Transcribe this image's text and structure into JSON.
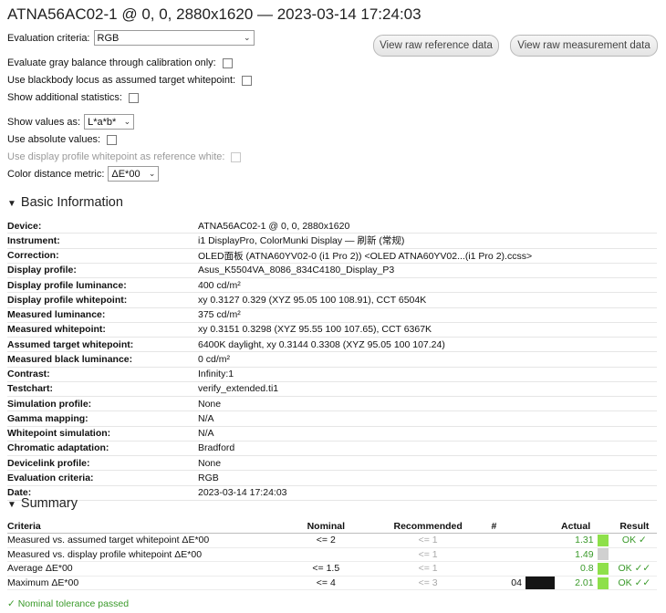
{
  "title": "ATNA56AC02-1 @ 0, 0, 2880x1620 — 2023-03-14 17:24:03",
  "controls": {
    "eval_criteria_label": "Evaluation criteria:",
    "eval_criteria_value": "RGB",
    "gray_balance_label": "Evaluate gray balance through calibration only:",
    "blackbody_label": "Use blackbody locus as assumed target whitepoint:",
    "additional_stats_label": "Show additional statistics:",
    "show_values_label": "Show values as:",
    "show_values_value": "L*a*b*",
    "absolute_label": "Use absolute values:",
    "display_profile_wp_label": "Use display profile whitepoint as reference white:",
    "color_distance_label": "Color distance metric:",
    "color_distance_value": "ΔE*00"
  },
  "buttons": {
    "raw_reference": "View raw reference data",
    "raw_measurement": "View raw measurement data"
  },
  "basic": {
    "heading": "Basic Information",
    "rows": [
      {
        "k": "Device:",
        "v": "ATNA56AC02-1 @ 0, 0, 2880x1620"
      },
      {
        "k": "Instrument:",
        "v": "i1 DisplayPro, ColorMunki Display — 刷新 (常规)"
      },
      {
        "k": "Correction:",
        "v": "OLED面板 (ATNA60YV02-0 (i1 Pro 2)) <OLED ATNA60YV02...(i1 Pro 2).ccss>"
      },
      {
        "k": "Display profile:",
        "v": "Asus_K5504VA_8086_834C4180_Display_P3"
      },
      {
        "k": "Display profile luminance:",
        "v": "400 cd/m²"
      },
      {
        "k": "Display profile whitepoint:",
        "v": "xy 0.3127 0.329 (XYZ 95.05 100 108.91), CCT 6504K"
      },
      {
        "k": "Measured luminance:",
        "v": "375 cd/m²"
      },
      {
        "k": "Measured whitepoint:",
        "v": "xy 0.3151 0.3298 (XYZ 95.55 100 107.65), CCT 6367K"
      },
      {
        "k": "Assumed target whitepoint:",
        "v": "6400K daylight, xy 0.3144 0.3308 (XYZ 95.05 100 107.24)"
      },
      {
        "k": "Measured black luminance:",
        "v": "0 cd/m²"
      },
      {
        "k": "Contrast:",
        "v": "Infinity:1"
      },
      {
        "k": "Testchart:",
        "v": "verify_extended.ti1"
      },
      {
        "k": "Simulation profile:",
        "v": "None"
      },
      {
        "k": "Gamma mapping:",
        "v": "N/A"
      },
      {
        "k": "Whitepoint simulation:",
        "v": "N/A"
      },
      {
        "k": "Chromatic adaptation:",
        "v": "Bradford"
      },
      {
        "k": "Devicelink profile:",
        "v": "None"
      },
      {
        "k": "Evaluation criteria:",
        "v": "RGB"
      },
      {
        "k": "Date:",
        "v": "2023-03-14 17:24:03"
      }
    ]
  },
  "summary": {
    "heading": "Summary",
    "columns": {
      "criteria": "Criteria",
      "nominal": "Nominal",
      "recommended": "Recommended",
      "num": "#",
      "actual": "Actual",
      "result": "Result"
    },
    "rows": [
      {
        "criteria": "Measured vs. assumed target whitepoint ΔE*00",
        "nominal": "<= 2",
        "recommended": "<= 1",
        "num": "",
        "actual": "1.31",
        "result": "OK ✓",
        "color": "#8ee04a",
        "swatch": ""
      },
      {
        "criteria": "Measured vs. display profile whitepoint ΔE*00",
        "nominal": "",
        "recommended": "<= 1",
        "num": "",
        "actual": "1.49",
        "result": "",
        "color": "#d0d0d0",
        "swatch": ""
      },
      {
        "criteria": "Average ΔE*00",
        "nominal": "<= 1.5",
        "recommended": "<= 1",
        "num": "",
        "actual": "0.8",
        "result": "OK ✓✓",
        "color": "#8ee04a",
        "swatch": ""
      },
      {
        "criteria": "Maximum ΔE*00",
        "nominal": "<= 4",
        "recommended": "<= 3",
        "num": "04",
        "actual": "2.01",
        "result": "OK ✓✓",
        "color": "#8ee04a",
        "swatch": "#151515"
      }
    ],
    "footer": "✓ Nominal tolerance passed"
  }
}
